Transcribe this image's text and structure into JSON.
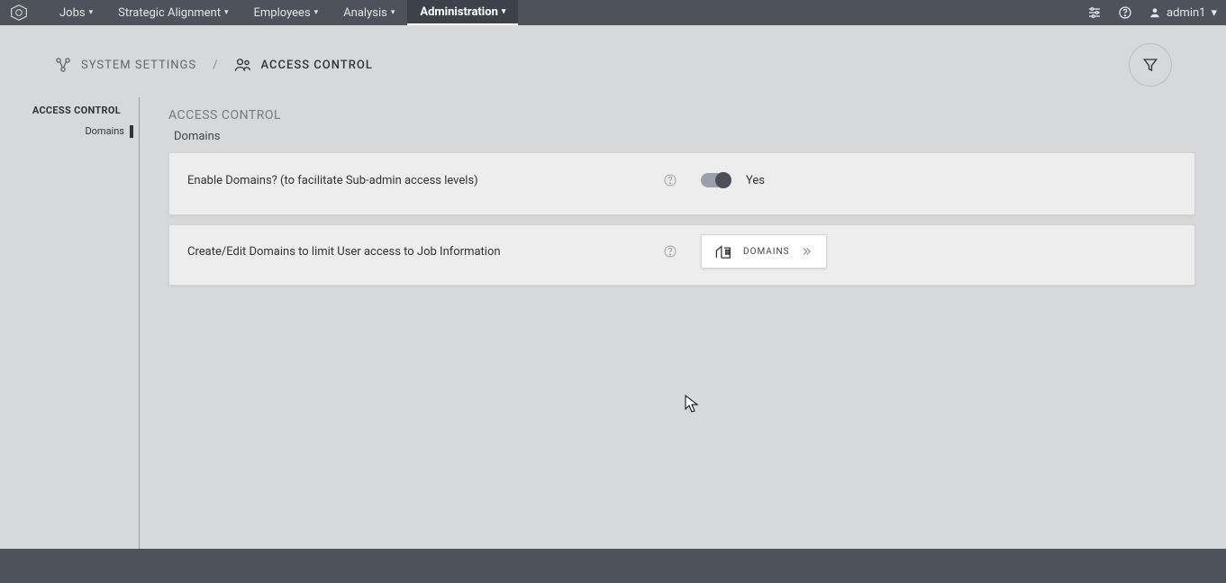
{
  "nav": {
    "items": [
      {
        "label": "Jobs",
        "active": false
      },
      {
        "label": "Strategic Alignment",
        "active": false
      },
      {
        "label": "Employees",
        "active": false
      },
      {
        "label": "Analysis",
        "active": false
      },
      {
        "label": "Administration",
        "active": true
      }
    ],
    "user": "admin1"
  },
  "breadcrumb": {
    "root": "SYSTEM SETTINGS",
    "sep": "/",
    "current": "ACCESS CONTROL"
  },
  "sidebar": {
    "head": "ACCESS CONTROL",
    "sub": "Domains"
  },
  "section": {
    "title": "ACCESS CONTROL",
    "sub": "Domains"
  },
  "cards": {
    "enable": {
      "label": "Enable Domains? (to facilitate Sub-admin access levels)",
      "toggle_state": "Yes"
    },
    "create": {
      "label": "Create/Edit Domains to limit User access to Job Information",
      "button": "DOMAINS"
    }
  }
}
